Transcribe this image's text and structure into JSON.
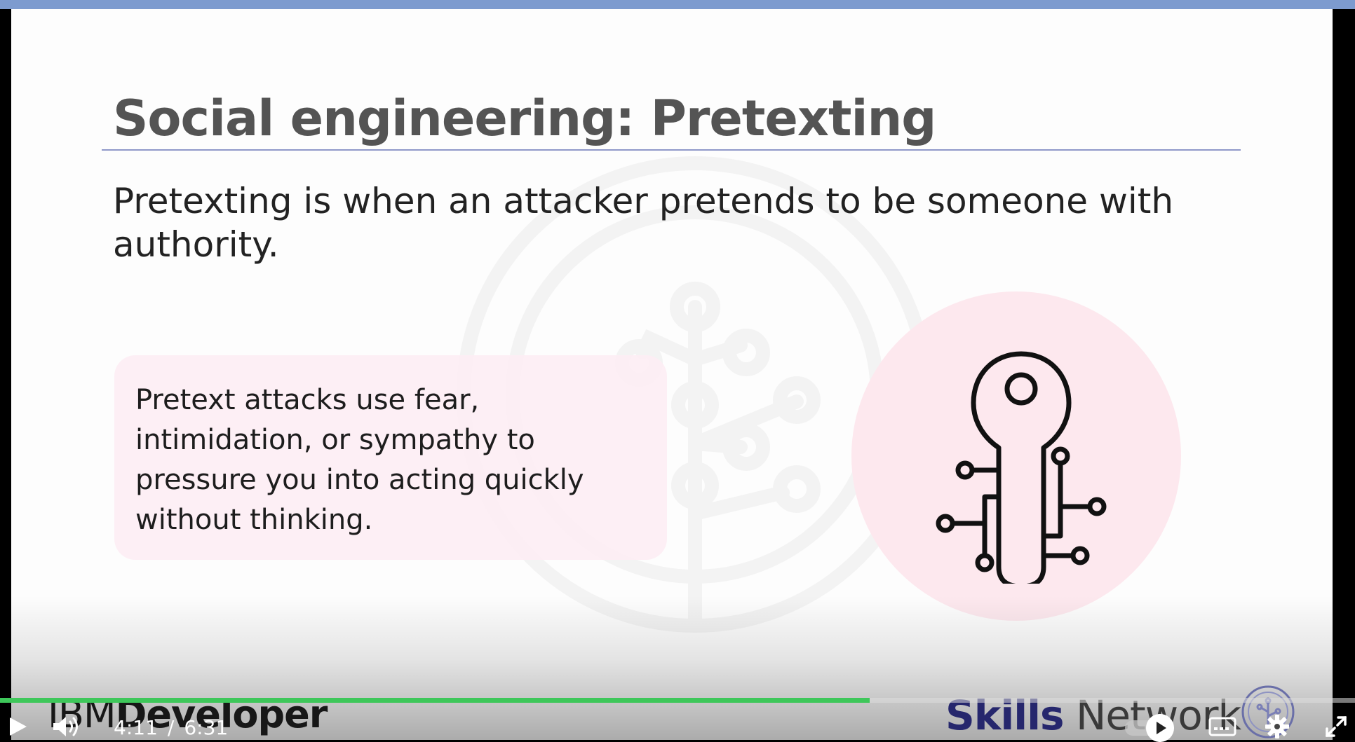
{
  "slide": {
    "title": "Social engineering: Pretexting",
    "lead_line1": "Pretexting is when an attacker pretends to be someone with",
    "lead_line2": "authority.",
    "callout_lines": [
      "Pretext attacks use fear,",
      "intimidation, or sympathy to",
      "pressure you into acting quickly",
      "without thinking."
    ],
    "icon": "circuit-key-icon",
    "watermark_icon": "skills-network-tree-icon"
  },
  "branding": {
    "left_light": "IBM",
    "left_bold": "Developer",
    "right_bold": "Skills",
    "right_light": " Network"
  },
  "player": {
    "current_time": "4:11",
    "separator": "/",
    "duration": "6:31",
    "progress": 0.642,
    "autoplay_on": true,
    "colors": {
      "progress": "#3ec75a",
      "top_line": "#7d9bcf",
      "title_rule": "#8f98c9",
      "callout_bg": "#fdeef4",
      "circle_bg": "#fde8ee"
    },
    "icons": {
      "play": "play-icon",
      "volume": "volume-icon",
      "captions": "captions-icon",
      "settings": "gear-icon",
      "fullscreen": "fullscreen-icon"
    }
  }
}
